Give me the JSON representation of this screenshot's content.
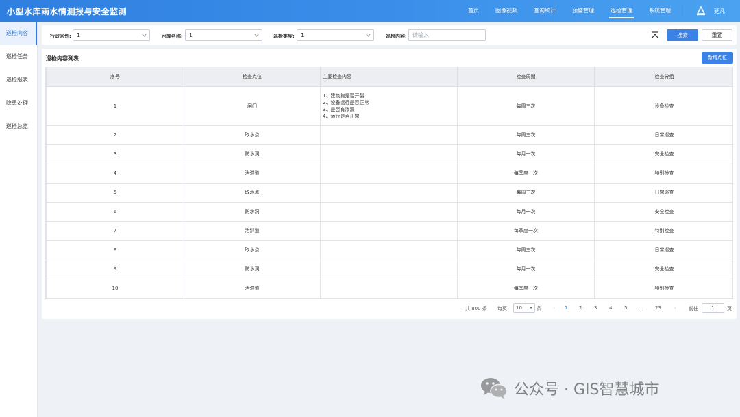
{
  "app": {
    "title": "小型水库雨水情测报与安全监测"
  },
  "nav": {
    "items": [
      {
        "label": "首页"
      },
      {
        "label": "图像视频"
      },
      {
        "label": "查询统计"
      },
      {
        "label": "预警管理"
      },
      {
        "label": "巡检管理",
        "active": true
      },
      {
        "label": "系统管理"
      }
    ],
    "user_name": "延凡"
  },
  "sidebar": {
    "items": [
      {
        "label": "巡检内容",
        "active": true
      },
      {
        "label": "巡检任务"
      },
      {
        "label": "巡检报表"
      },
      {
        "label": "隐患处理"
      },
      {
        "label": "巡检总览"
      }
    ]
  },
  "filters": {
    "region_label": "行政区划:",
    "region_value": "1",
    "reservoir_label": "水库名称:",
    "reservoir_value": "1",
    "type_label": "巡检类型:",
    "type_value": "1",
    "content_label": "巡检内容:",
    "content_value": "",
    "content_placeholder": "请输入",
    "search_label": "搜索",
    "reset_label": "重置"
  },
  "panel": {
    "title": "巡检内容列表",
    "add_label": "新增点位"
  },
  "table": {
    "columns": [
      "序号",
      "检查点位",
      "主要检查内容",
      "检查周期",
      "检查分组"
    ],
    "rows": [
      {
        "no": "1",
        "point": "闸门",
        "content": [
          "1、建筑物是否开裂",
          "2、设备运行是否正常",
          "3、是否有渗漏",
          "4、运行是否正常"
        ],
        "cycle": "每周三次",
        "group": "设备检查"
      },
      {
        "no": "2",
        "point": "取水点",
        "content": [],
        "cycle": "每周三次",
        "group": "日常巡查"
      },
      {
        "no": "3",
        "point": "防水洞",
        "content": [],
        "cycle": "每月一次",
        "group": "安全检查"
      },
      {
        "no": "4",
        "point": "泄洪道",
        "content": [],
        "cycle": "每季度一次",
        "group": "特别检查"
      },
      {
        "no": "5",
        "point": "取水点",
        "content": [],
        "cycle": "每周三次",
        "group": "日常巡查"
      },
      {
        "no": "6",
        "point": "防水洞",
        "content": [],
        "cycle": "每月一次",
        "group": "安全检查"
      },
      {
        "no": "7",
        "point": "泄洪道",
        "content": [],
        "cycle": "每季度一次",
        "group": "特别检查"
      },
      {
        "no": "8",
        "point": "取水点",
        "content": [],
        "cycle": "每周三次",
        "group": "日常巡查"
      },
      {
        "no": "9",
        "point": "防水洞",
        "content": [],
        "cycle": "每月一次",
        "group": "安全检查"
      },
      {
        "no": "10",
        "point": "泄洪道",
        "content": [],
        "cycle": "每季度一次",
        "group": "特别检查"
      }
    ]
  },
  "pagination": {
    "total_text": "共 800 条",
    "per_page_label": "每页",
    "page_size": "10",
    "per_page_unit": "条",
    "prev": "‹",
    "pages": [
      "1",
      "2",
      "3",
      "4",
      "5",
      "…",
      "23"
    ],
    "next": "›",
    "goto_label": "前往",
    "goto_value": "1",
    "goto_unit": "页"
  },
  "watermark": {
    "text": "公众号 · GIS智慧城市"
  },
  "colors": {
    "primary": "#3b82e6",
    "header_start": "#2f7fe0",
    "header_end": "#4ba2f0"
  }
}
